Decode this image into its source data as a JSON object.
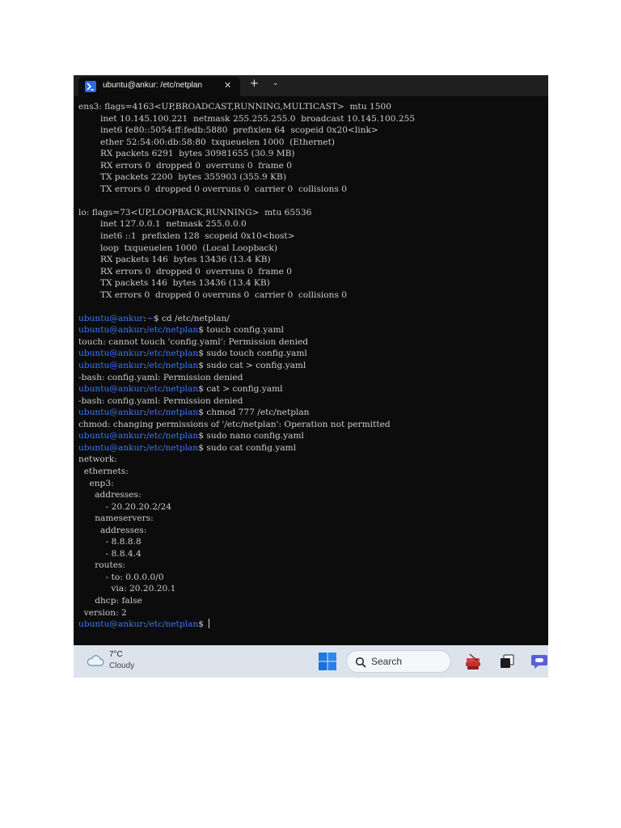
{
  "titlebar": {
    "tab_title": "ubuntu@ankur: /etc/netplan",
    "close_glyph": "✕",
    "new_tab_glyph": "+",
    "dropdown_glyph": "⌄",
    "tab_icon": "terminal-icon"
  },
  "terminal": {
    "prompt_user": "ubuntu@ankur",
    "lines": [
      {
        "text": "ens3: flags=4163<UP,BROADCAST,RUNNING,MULTICAST>  mtu 1500"
      },
      {
        "text": "        inet 10.145.100.221  netmask 255.255.255.0  broadcast 10.145.100.255"
      },
      {
        "text": "        inet6 fe80::5054:ff:fedb:5880  prefixlen 64  scopeid 0x20<link>"
      },
      {
        "text": "        ether 52:54:00:db:58:80  txqueuelen 1000  (Ethernet)"
      },
      {
        "text": "        RX packets 6291  bytes 30981655 (30.9 MB)"
      },
      {
        "text": "        RX errors 0  dropped 0  overruns 0  frame 0"
      },
      {
        "text": "        TX packets 2200  bytes 355903 (355.9 KB)"
      },
      {
        "text": "        TX errors 0  dropped 0 overruns 0  carrier 0  collisions 0"
      },
      {
        "text": ""
      },
      {
        "text": "lo: flags=73<UP,LOOPBACK,RUNNING>  mtu 65536"
      },
      {
        "text": "        inet 127.0.0.1  netmask 255.0.0.0"
      },
      {
        "text": "        inet6 ::1  prefixlen 128  scopeid 0x10<host>"
      },
      {
        "text": "        loop  txqueuelen 1000  (Local Loopback)"
      },
      {
        "text": "        RX packets 146  bytes 13436 (13.4 KB)"
      },
      {
        "text": "        RX errors 0  dropped 0  overruns 0  frame 0"
      },
      {
        "text": "        TX packets 146  bytes 13436 (13.4 KB)"
      },
      {
        "text": "        TX errors 0  dropped 0 overruns 0  carrier 0  collisions 0"
      },
      {
        "text": ""
      },
      {
        "path": "~",
        "cmd": " cd /etc/netplan/"
      },
      {
        "path": "/etc/netplan",
        "cmd": " touch config.yaml"
      },
      {
        "text": "touch: cannot touch 'config.yaml': Permission denied"
      },
      {
        "path": "/etc/netplan",
        "cmd": " sudo touch config.yaml"
      },
      {
        "path": "/etc/netplan",
        "cmd": " sudo cat > config.yaml"
      },
      {
        "text": "-bash: config.yaml: Permission denied"
      },
      {
        "path": "/etc/netplan",
        "cmd": " cat > config.yaml"
      },
      {
        "text": "-bash: config.yaml: Permission denied"
      },
      {
        "path": "/etc/netplan",
        "cmd": " chmod 777 /etc/netplan"
      },
      {
        "text": "chmod: changing permissions of '/etc/netplan': Operation not permitted"
      },
      {
        "path": "/etc/netplan",
        "cmd": " sudo nano config.yaml"
      },
      {
        "path": "/etc/netplan",
        "cmd": " sudo cat config.yaml"
      },
      {
        "text": "network:"
      },
      {
        "text": "  ethernets:"
      },
      {
        "text": "    enp3:"
      },
      {
        "text": "      addresses:"
      },
      {
        "text": "          - 20.20.20.2/24"
      },
      {
        "text": "      nameservers:"
      },
      {
        "text": "        addresses:"
      },
      {
        "text": "          - 8.8.8.8"
      },
      {
        "text": "          - 8.8.4.4"
      },
      {
        "text": "      routes:"
      },
      {
        "text": "          - to: 0.0.0.0/0"
      },
      {
        "text": "            via: 20.20.20.1"
      },
      {
        "text": "      dhcp: false"
      },
      {
        "text": "  version: 2"
      },
      {
        "path": "/etc/netplan",
        "cmd": " ",
        "cursor": true
      }
    ]
  },
  "taskbar": {
    "weather_temp": "7°C",
    "weather_condition": "Cloudy",
    "weather_icon": "cloud-icon",
    "search_label": "Search",
    "start_icon": "windows-start-icon",
    "search_icon": "search-icon",
    "pinned_apps": [
      "stacked-app-icon",
      "task-view-icon",
      "chat-app-icon"
    ]
  },
  "colors": {
    "terminal_bg": "#0c0c0c",
    "terminal_fg": "#cccccc",
    "prompt_blue": "#3b78ff",
    "taskbar_bg": "#dde3ec"
  }
}
